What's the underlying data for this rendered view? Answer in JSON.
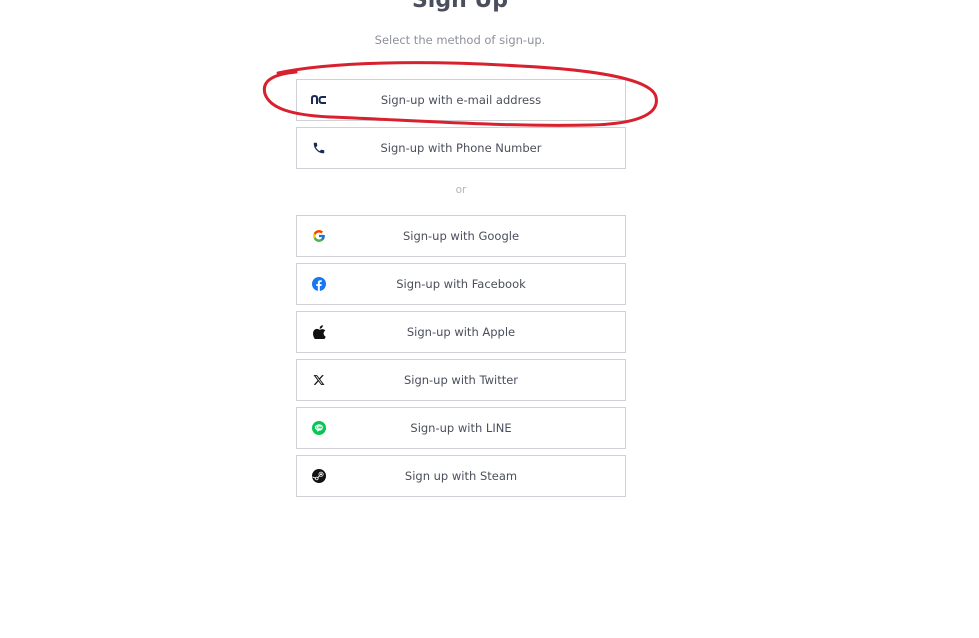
{
  "page": {
    "title": "Sign Up",
    "subtitle": "Select the method of sign-up.",
    "divider": "or"
  },
  "options": [
    {
      "label": "Sign-up with e-mail address",
      "icon": "nc-logo-icon"
    },
    {
      "label": "Sign-up with Phone Number",
      "icon": "phone-icon"
    },
    {
      "label": "Sign-up with Google",
      "icon": "google-icon"
    },
    {
      "label": "Sign-up with Facebook",
      "icon": "facebook-icon"
    },
    {
      "label": "Sign-up with Apple",
      "icon": "apple-icon"
    },
    {
      "label": "Sign-up with Twitter",
      "icon": "x-twitter-icon"
    },
    {
      "label": "Sign-up with LINE",
      "icon": "line-icon"
    },
    {
      "label": "Sign up with Steam",
      "icon": "steam-icon"
    }
  ],
  "colors": {
    "annotation": "#d8202e",
    "border": "#cfd1d6",
    "facebook": "#1877f2",
    "line": "#06c755",
    "nc": "#1b2a55"
  }
}
